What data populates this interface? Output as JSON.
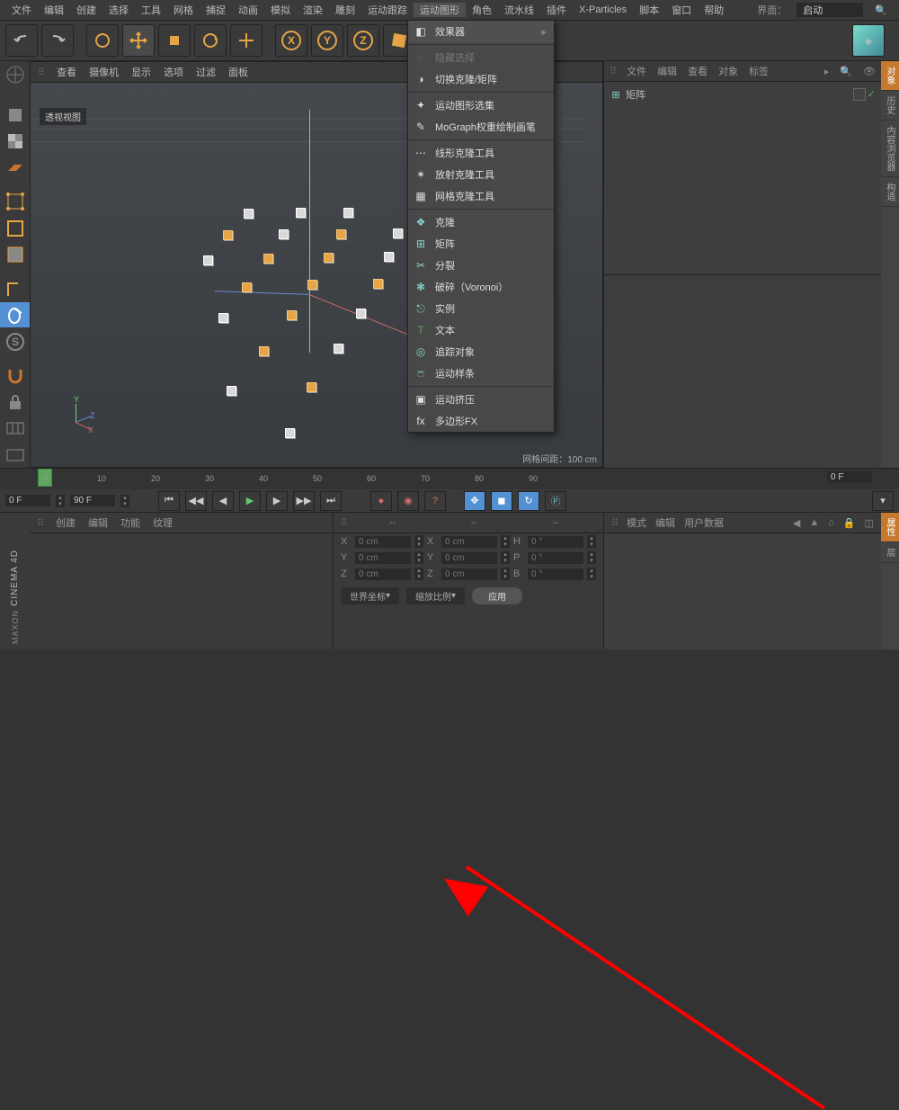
{
  "menu": [
    "文件",
    "编辑",
    "创建",
    "选择",
    "工具",
    "网格",
    "捕捉",
    "动画",
    "模拟",
    "渲染",
    "雕刻",
    "运动跟踪",
    "运动图形",
    "角色",
    "流水线",
    "插件",
    "X-Particles",
    "脚本",
    "窗口",
    "帮助"
  ],
  "menu_active": "运动图形",
  "layout_label": "界面：",
  "layout_value": "启动",
  "viewport": {
    "menu": [
      "查看",
      "摄像机",
      "显示",
      "选项",
      "过滤",
      "面板"
    ],
    "title": "透视视图",
    "grid": "网格间距：100 cm"
  },
  "dropdown": {
    "header": {
      "label": "效果器",
      "icon": "◧"
    },
    "groups": [
      [
        {
          "icon": "◌",
          "label": "隐藏选择",
          "dim": true
        },
        {
          "icon": "◑",
          "label": "切换克隆/矩阵"
        }
      ],
      [
        {
          "icon": "✦",
          "label": "运动图形选集"
        },
        {
          "icon": "✎",
          "label": "MoGraph权重绘制画笔"
        }
      ],
      [
        {
          "icon": "⋯",
          "label": "线形克隆工具"
        },
        {
          "icon": "✶",
          "label": "放射克隆工具"
        },
        {
          "icon": "▦",
          "label": "网格克隆工具"
        }
      ],
      [
        {
          "icon": "❖",
          "label": "克隆",
          "color": "#87d6d0"
        },
        {
          "icon": "⊞",
          "label": "矩阵",
          "color": "#87d6d0"
        },
        {
          "icon": "✂",
          "label": "分裂",
          "color": "#87d6d0"
        },
        {
          "icon": "❃",
          "label": "破碎（Voronoi）",
          "color": "#87d6d0"
        },
        {
          "icon": "⎋",
          "label": "实例",
          "color": "#87d6d0"
        },
        {
          "icon": "T",
          "label": "文本",
          "color": "#5fa65f"
        },
        {
          "icon": "◎",
          "label": "追踪对象",
          "color": "#87d6d0"
        },
        {
          "icon": "ෆ",
          "label": "运动样条",
          "color": "#87d6d0"
        }
      ],
      [
        {
          "icon": "▣",
          "label": "运动挤压"
        },
        {
          "icon": "fx",
          "label": "多边形FX"
        }
      ]
    ]
  },
  "objects": {
    "menu": [
      "文件",
      "编辑",
      "查看",
      "对象",
      "标签"
    ],
    "item": {
      "name": "矩阵"
    }
  },
  "timeline": {
    "start": "0 F",
    "end": "90 F",
    "current": "0 F",
    "ticks": [
      0,
      10,
      20,
      30,
      40,
      50,
      60,
      70,
      80,
      90
    ]
  },
  "materials": {
    "menu": [
      "创建",
      "编辑",
      "功能",
      "纹理"
    ]
  },
  "coord": {
    "cols": [
      "--",
      "--",
      "--"
    ],
    "rows": [
      {
        "l": "X",
        "v1": "0 cm",
        "l2": "X",
        "v2": "0 cm",
        "l3": "H",
        "v3": "0 °"
      },
      {
        "l": "Y",
        "v1": "0 cm",
        "l2": "Y",
        "v2": "0 cm",
        "l3": "P",
        "v3": "0 °"
      },
      {
        "l": "Z",
        "v1": "0 cm",
        "l2": "Z",
        "v2": "0 cm",
        "l3": "B",
        "v3": "0 °"
      }
    ],
    "btn1": "世界坐标",
    "btn2": "缩放比例",
    "apply": "应用"
  },
  "attr": {
    "menu": [
      "模式",
      "编辑",
      "用户数据"
    ]
  },
  "right_tabs": [
    "对象",
    "历史",
    "内容浏览器",
    "构造"
  ]
}
